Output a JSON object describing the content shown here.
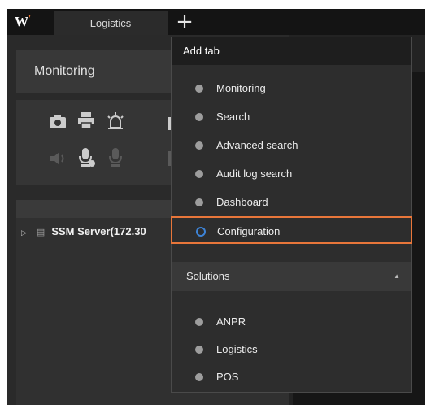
{
  "app": {
    "logo_text": "W",
    "logo_mark": "'"
  },
  "tabs": [
    {
      "label": "Logistics"
    }
  ],
  "add_tab_button": {
    "label": "+"
  },
  "left_panel": {
    "section_title": "Monitoring",
    "toolbar_icons": [
      "camera-icon",
      "print-icon",
      "alarm-icon",
      "panel-icon",
      "speaker-icon",
      "mic-settings-icon",
      "mic-icon",
      "grid-icon"
    ],
    "tree": [
      {
        "arrow": "▷",
        "label": "SSM Server(172.30"
      }
    ]
  },
  "add_tab_menu": {
    "title": "Add tab",
    "items": [
      {
        "label": "Monitoring"
      },
      {
        "label": "Search"
      },
      {
        "label": "Advanced search"
      },
      {
        "label": "Audit log search"
      },
      {
        "label": "Dashboard"
      },
      {
        "label": "Configuration",
        "selected": true
      }
    ],
    "solutions": {
      "title": "Solutions",
      "items": [
        {
          "label": "ANPR"
        },
        {
          "label": "Logistics"
        },
        {
          "label": "POS"
        }
      ]
    }
  },
  "colors": {
    "highlight": "#e8763a",
    "selected_ring": "#3d83d6",
    "background": "#232323"
  }
}
